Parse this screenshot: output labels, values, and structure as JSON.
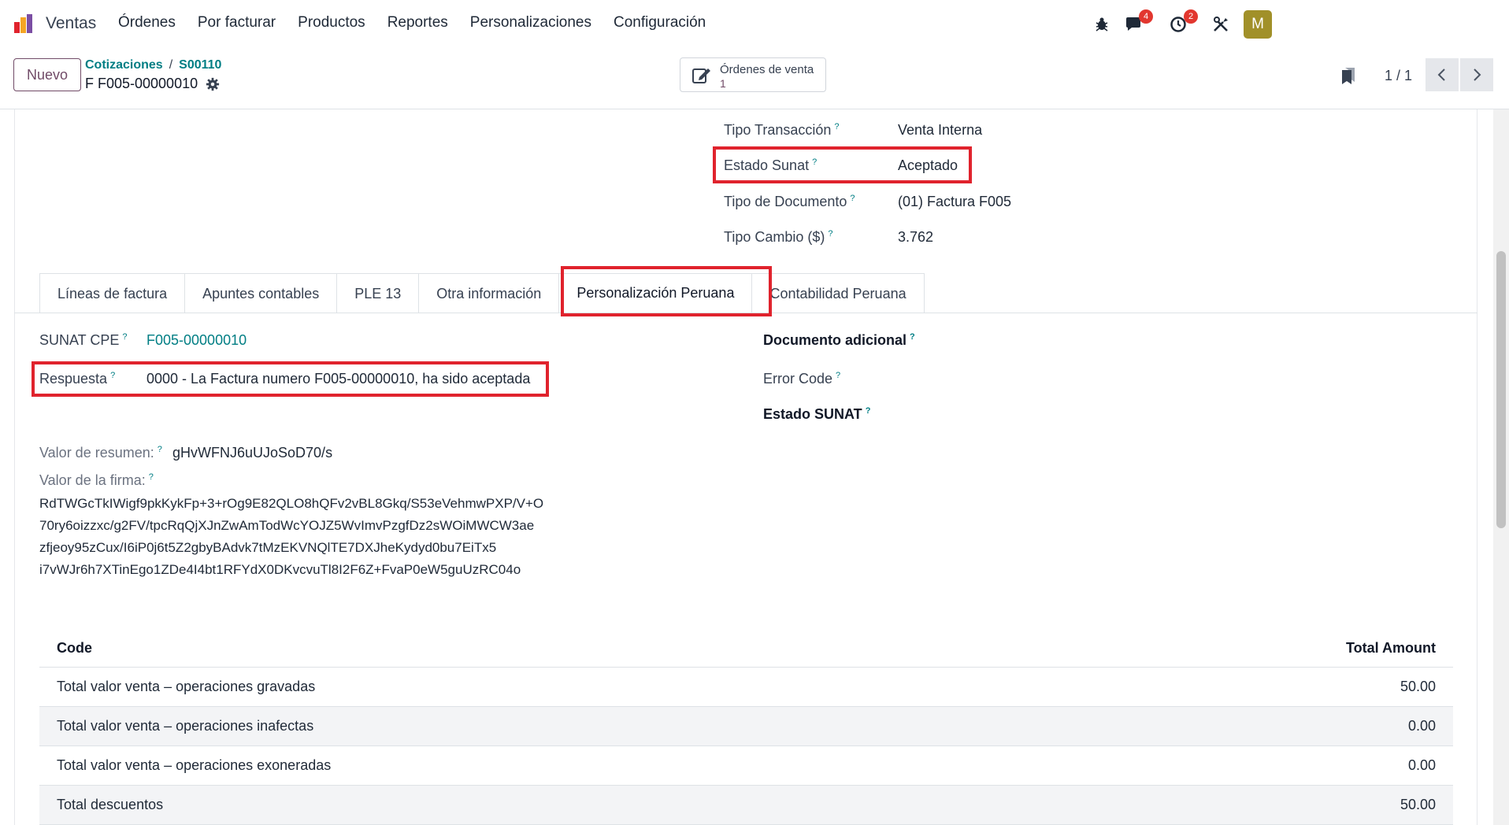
{
  "navbar": {
    "app_name": "Ventas",
    "menu": [
      "Órdenes",
      "Por facturar",
      "Productos",
      "Reportes",
      "Personalizaciones",
      "Configuración"
    ],
    "messages_count": "4",
    "activities_count": "2",
    "avatar_initial": "M"
  },
  "control": {
    "new_button": "Nuevo",
    "breadcrumb_parent": "Cotizaciones",
    "breadcrumb_child": "S00110",
    "record_name": "F F005-00000010",
    "smart_button_label": "Órdenes de venta",
    "smart_button_value": "1",
    "pager": "1 / 1"
  },
  "header_fields": {
    "tipo_transaccion_label": "Tipo Transacción",
    "tipo_transaccion_value": "Venta Interna",
    "estado_sunat_label": "Estado Sunat",
    "estado_sunat_value": "Aceptado",
    "tipo_documento_label": "Tipo de Documento",
    "tipo_documento_value": "(01) Factura F005",
    "tipo_cambio_label": "Tipo Cambio ($)",
    "tipo_cambio_value": "3.762"
  },
  "tabs": [
    "Líneas de factura",
    "Apuntes contables",
    "PLE 13",
    "Otra información",
    "Personalización Peruana",
    "Contabilidad Peruana"
  ],
  "active_tab": "Personalización Peruana",
  "peru_tab": {
    "sunat_cpe_label": "SUNAT CPE",
    "sunat_cpe_value": "F005-00000010",
    "respuesta_label": "Respuesta",
    "respuesta_value": "0000 - La Factura numero F005-00000010, ha sido aceptada",
    "documento_adicional_label": "Documento adicional",
    "error_code_label": "Error Code",
    "estado_sunat_label": "Estado SUNAT",
    "valor_resumen_label": "Valor de resumen:",
    "valor_resumen_value": "gHvWFNJ6uUJoSoD70/s",
    "valor_firma_label": "Valor de la firma:",
    "valor_firma_lines": [
      "RdTWGcTkIWigf9pkKykFp+3+rOg9E82QLO8hQFv2vBL8Gkq/S53eVehmwPXP/V+O",
      "70ry6oizzxc/g2FV/tpcRqQjXJnZwAmTodWcYOJZ5WvImvPzgfDz2sWOiMWCW3ae",
      "zfjeoy95zCux/I6iP0j6t5Z2gbyBAdvk7tMzEKVNQlTE7DXJheKydyd0bu7EiTx5",
      "i7vWJr6h7XTinEgo1ZDe4I4bt1RFYdX0DKvcvuTl8I2F6Z+FvaP0eW5guUzRC04o"
    ]
  },
  "totals_table": {
    "col_code": "Code",
    "col_amount": "Total Amount",
    "rows": [
      {
        "code": "Total valor venta – operaciones gravadas",
        "amount": "50.00"
      },
      {
        "code": "Total valor venta – operaciones inafectas",
        "amount": "0.00"
      },
      {
        "code": "Total valor venta – operaciones exoneradas",
        "amount": "0.00"
      },
      {
        "code": "Total descuentos",
        "amount": "50.00"
      }
    ]
  },
  "colors": {
    "primary": "#714b67",
    "link": "#017e84",
    "highlight": "#e0232d",
    "badge": "#e2372f"
  },
  "icons": [
    "app-logo-icon",
    "bug-icon",
    "chat-icon",
    "clock-icon",
    "tools-icon",
    "gear-icon",
    "edit-icon",
    "bookmark-icon",
    "chevron-left-icon",
    "chevron-right-icon"
  ]
}
